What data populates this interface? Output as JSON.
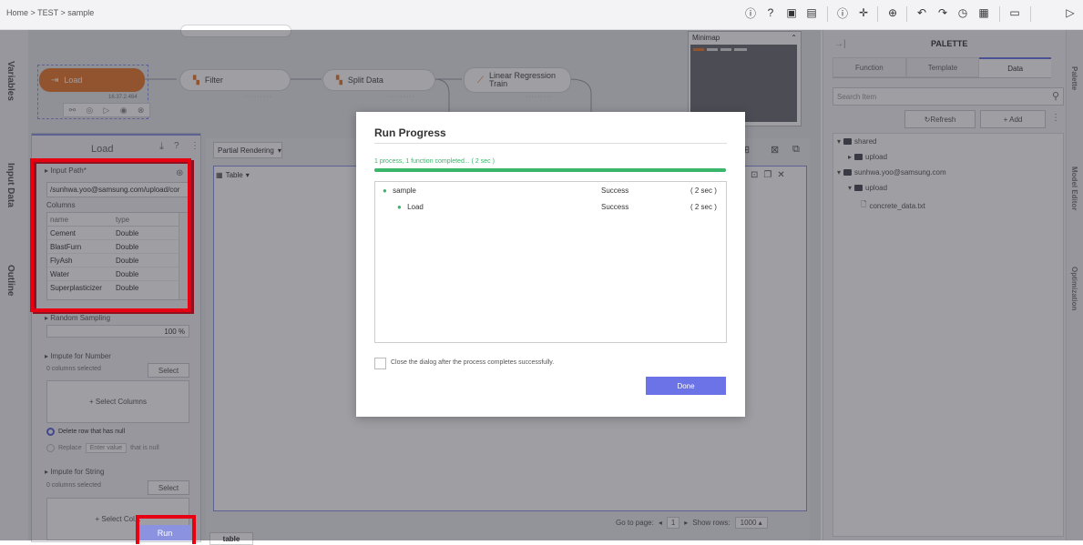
{
  "breadcrumb": "Home > TEST > sample",
  "toolbar_icons": [
    "info-icon",
    "help-icon",
    "save-icon",
    "save-as-icon",
    "info-icon",
    "move-icon",
    "zoom-icon",
    "undo-icon",
    "redo-icon",
    "history-icon",
    "export-icon",
    "table-icon",
    "play-icon"
  ],
  "left_tabs": [
    "Variables",
    "Input Data",
    "Outline"
  ],
  "pipeline": {
    "load": {
      "label": "Load",
      "version": "16.37.2.464"
    },
    "filter": "Filter",
    "split": "Split Data",
    "lr_line1": "Linear Regression",
    "lr_line2": "Train",
    "minimap": "Minimap"
  },
  "load_panel": {
    "title": "Load",
    "input_path_label": "Input Path",
    "input_path_value": "/sunhwa.yoo@samsung.com/upload/cor",
    "columns_label": "Columns",
    "col_headers": [
      "name",
      "type"
    ],
    "rows": [
      {
        "name": "Cement",
        "type": "Double"
      },
      {
        "name": "BlastFurn",
        "type": "Double"
      },
      {
        "name": "FlyAsh",
        "type": "Double"
      },
      {
        "name": "Water",
        "type": "Double"
      },
      {
        "name": "Superplasticizer",
        "type": "Double"
      }
    ],
    "random_sampling": "Random Sampling",
    "sampling_value": "100 %",
    "impute_number": "Impute for Number",
    "cols_selected_num": "0 columns selected",
    "select_btn": "Select",
    "select_columns": "+ Select Columns",
    "delete_row": "Delete row that has null",
    "replace": "Replace",
    "enter_value": "Enter value",
    "that_is_null": "that is null",
    "impute_string": "Impute for String",
    "cols_selected_str": "0 columns selected",
    "select_btn2": "Select",
    "select_columns2": "+ Select Col...",
    "run": "Run"
  },
  "render_bar": {
    "mode": "Partial Rendering",
    "table": "Table"
  },
  "bottom": {
    "tab": "table",
    "goto": "Go to page:",
    "page": "1",
    "show_rows": "Show rows:",
    "rows_value": "1000"
  },
  "palette": {
    "title": "PALETTE",
    "tabs": [
      "Function",
      "Template",
      "Data"
    ],
    "search_placeholder": "Search Item",
    "refresh": "Refresh",
    "add": "+ Add",
    "tree": [
      "shared",
      "upload",
      "sunhwa.yoo@samsung.com",
      "upload",
      "concrete_data.txt"
    ]
  },
  "right_strip": [
    "Palette",
    "Model Editor",
    "Optimization"
  ],
  "dialog": {
    "title": "Run Progress",
    "status": "1 process, 1 function completed... ( 2 sec )",
    "progress": 1.0,
    "rows": [
      {
        "name": "sample",
        "status": "Success",
        "time": "( 2 sec )"
      },
      {
        "name": "Load",
        "status": "Success",
        "time": "( 2 sec )"
      }
    ],
    "close_label": "Close the dialog after the process completes successfully.",
    "done": "Done"
  },
  "colors": {
    "accent": "#6b73e6",
    "orange": "#e8782a",
    "success": "#3ab56a",
    "highlight": "#e60012"
  }
}
